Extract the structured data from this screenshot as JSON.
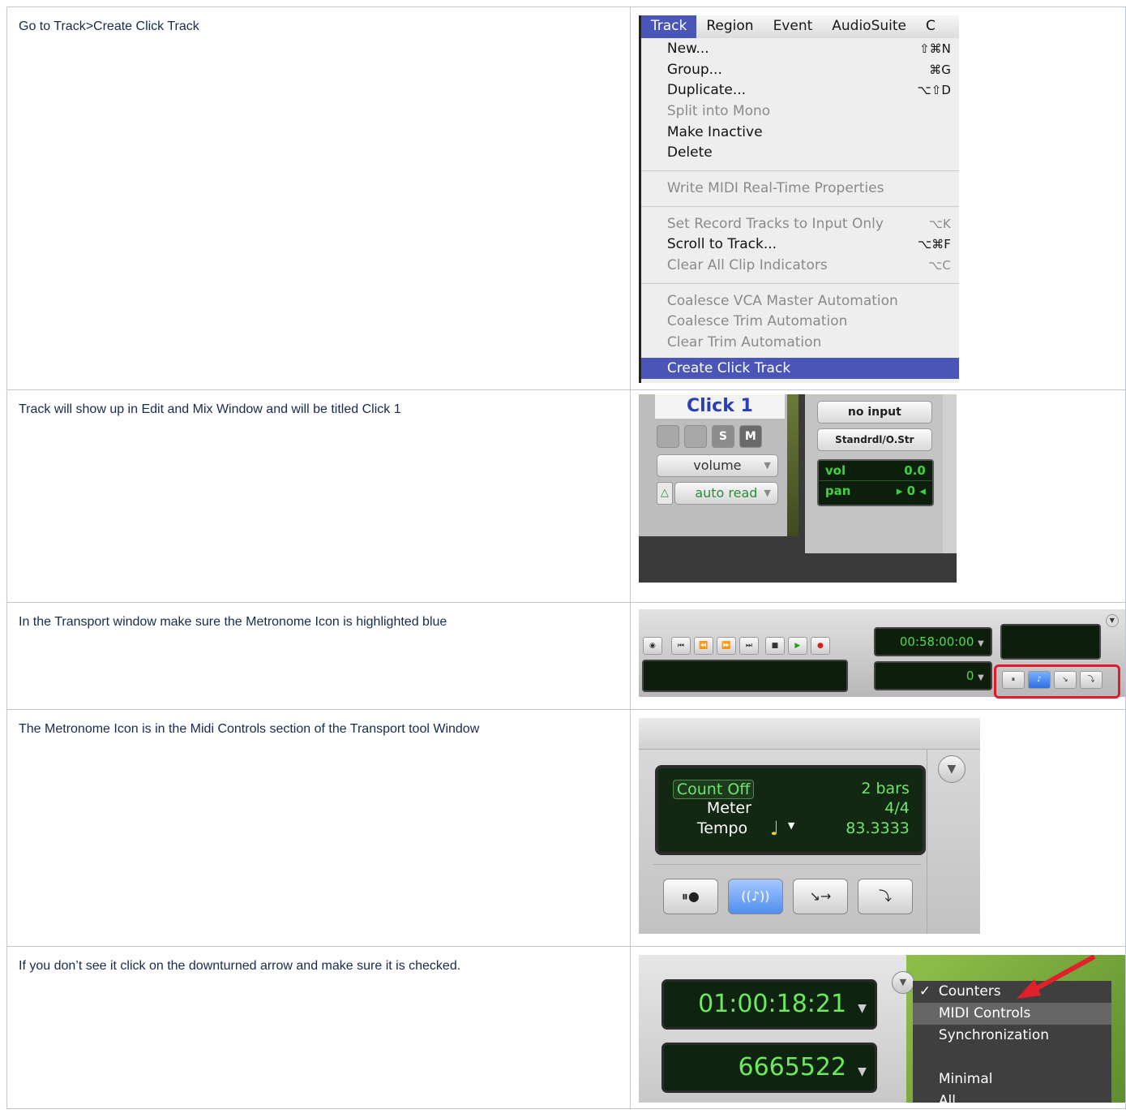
{
  "rows": [
    {
      "text": "Go to Track>Create Click Track",
      "menu": {
        "bar": [
          "Track",
          "Region",
          "Event",
          "AudioSuite",
          "C"
        ],
        "groups": [
          [
            {
              "label": "New...",
              "shortcut": "⇧⌘N",
              "disabled": false
            },
            {
              "label": "Group...",
              "shortcut": "⌘G",
              "disabled": false
            },
            {
              "label": "Duplicate...",
              "shortcut": "⌥⇧D",
              "disabled": false
            },
            {
              "label": "Split into Mono",
              "shortcut": "",
              "disabled": true
            },
            {
              "label": "Make Inactive",
              "shortcut": "",
              "disabled": false
            },
            {
              "label": "Delete",
              "shortcut": "",
              "disabled": false
            }
          ],
          [
            {
              "label": "Write MIDI Real-Time Properties",
              "shortcut": "",
              "disabled": true
            }
          ],
          [
            {
              "label": "Set Record Tracks to Input Only",
              "shortcut": "⌥K",
              "disabled": true
            },
            {
              "label": "Scroll to Track...",
              "shortcut": "⌥⌘F",
              "disabled": false
            },
            {
              "label": "Clear All Clip Indicators",
              "shortcut": "⌥C",
              "disabled": true
            }
          ],
          [
            {
              "label": "Coalesce VCA Master Automation",
              "shortcut": "",
              "disabled": true
            },
            {
              "label": "Coalesce Trim Automation",
              "shortcut": "",
              "disabled": true
            },
            {
              "label": "Clear Trim Automation",
              "shortcut": "",
              "disabled": true
            }
          ]
        ],
        "selected": "Create Click Track"
      }
    },
    {
      "text": "Track will show up in Edit and Mix Window and will be titled Click 1",
      "track": {
        "name": "Click 1",
        "solo": "S",
        "mute": "M",
        "view": "volume",
        "automation": "auto read",
        "input": "no input",
        "output": "Standrdl/O.Str",
        "vol_label": "vol",
        "vol_value": "0.0",
        "pan_label": "pan",
        "pan_value": "▸ 0 ◂"
      }
    },
    {
      "text": "In the Transport window make sure the Metronome Icon is highlighted blue",
      "transport": {
        "main_counter": "00:58:00:00",
        "sub_counter": "0"
      }
    },
    {
      "text": "The Metronome Icon is in the Midi Controls section of the Transport tool Window",
      "midi": {
        "count_off": "Count Off",
        "count_off_value": "2 bars",
        "meter": "Meter",
        "meter_value": "4/4",
        "tempo": "Tempo",
        "tempo_value": "83.3333"
      }
    },
    {
      "text": "If you don’t see it click on the downturned arrow and make sure it is checked.",
      "counters": {
        "main": "01:00:18:21",
        "sub": "6665522",
        "menu": [
          {
            "label": "Counters",
            "checked": true
          },
          {
            "label": "MIDI Controls",
            "checked": false
          },
          {
            "label": "Synchronization",
            "checked": false
          },
          {
            "label": "",
            "checked": false
          },
          {
            "label": "Minimal",
            "checked": false
          },
          {
            "label": "All",
            "checked": false
          }
        ]
      }
    }
  ]
}
